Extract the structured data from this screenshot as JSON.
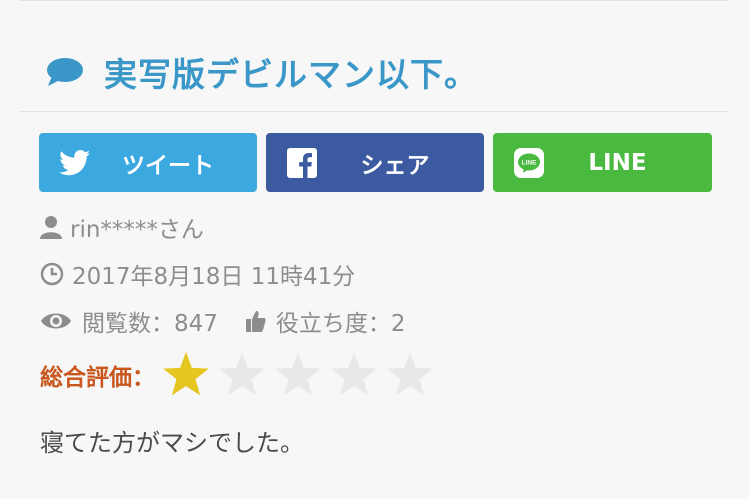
{
  "review": {
    "title": "実写版デビルマン以下。",
    "title_icon": "speech-bubble-icon",
    "accent_color": "#3a97c7",
    "share": {
      "twitter_label": "ツイート",
      "facebook_label": "シェア",
      "line_label": "LINE",
      "twitter_color": "#3ba9e0",
      "facebook_color": "#3c5a9f",
      "line_color": "#49b93f"
    },
    "user": "rin*****さん",
    "date": "2017年8月18日 11時41分",
    "views": "閲覧数：847",
    "helpful": "役立ち度：2",
    "rating_label": "総合評価：",
    "rating": 1,
    "rating_max": 5,
    "star_filled_color": "#e5c520",
    "star_empty_color": "#e8e8e8",
    "rating_label_color": "#c8561d",
    "comment": "寝てた方がマシでした。"
  }
}
